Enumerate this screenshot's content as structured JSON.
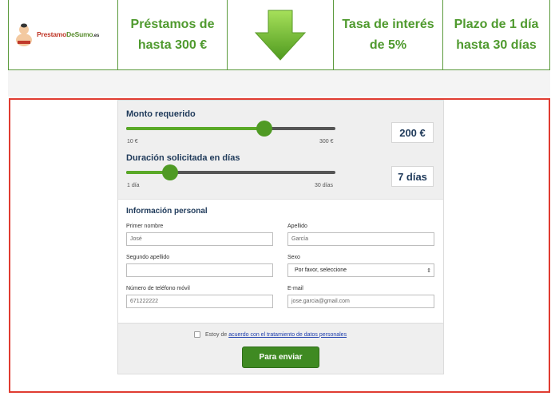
{
  "header": {
    "logo": {
      "text_main": "Prestamo",
      "text_accent": "DeSumo",
      "text_ext": ".es"
    },
    "loan": {
      "line1": "Préstamos de",
      "line2": "hasta 300 €"
    },
    "rate": {
      "line1": "Tasa de interés",
      "line2": "de 5%"
    },
    "term": {
      "line1": "Plazo de 1 día",
      "line2": "hasta 30 días"
    },
    "arrow_icon": "down-arrow-icon"
  },
  "sliders": {
    "amount": {
      "label": "Monto requerido",
      "min_label": "10 €",
      "max_label": "300 €",
      "value": "200 €",
      "fraction": 0.66
    },
    "duration": {
      "label": "Duración solicitada en días",
      "min_label": "1 día",
      "max_label": "30 días",
      "value": "7 días",
      "fraction": 0.21
    }
  },
  "personal": {
    "title": "Información personal",
    "first_name": {
      "label": "Primer nombre",
      "value": "José"
    },
    "last_name": {
      "label": "Apellido",
      "value": "García"
    },
    "second_last_name": {
      "label": "Segundo apellido",
      "value": ""
    },
    "sex": {
      "label": "Sexo",
      "value": "Por favor, seleccione"
    },
    "phone": {
      "label": "Número de teléfono móvil",
      "value": "671222222"
    },
    "email": {
      "label": "E-mail",
      "value": "jose.garcia@gmail.com"
    }
  },
  "consent": {
    "prefix": "Estoy de",
    "link": "acuerdo con el tratamiento de datos personales"
  },
  "submit_label": "Para enviar",
  "colors": {
    "brand_green": "#4f9a2e",
    "frame_red": "#e03c31",
    "label_navy": "#1f3a5a"
  }
}
